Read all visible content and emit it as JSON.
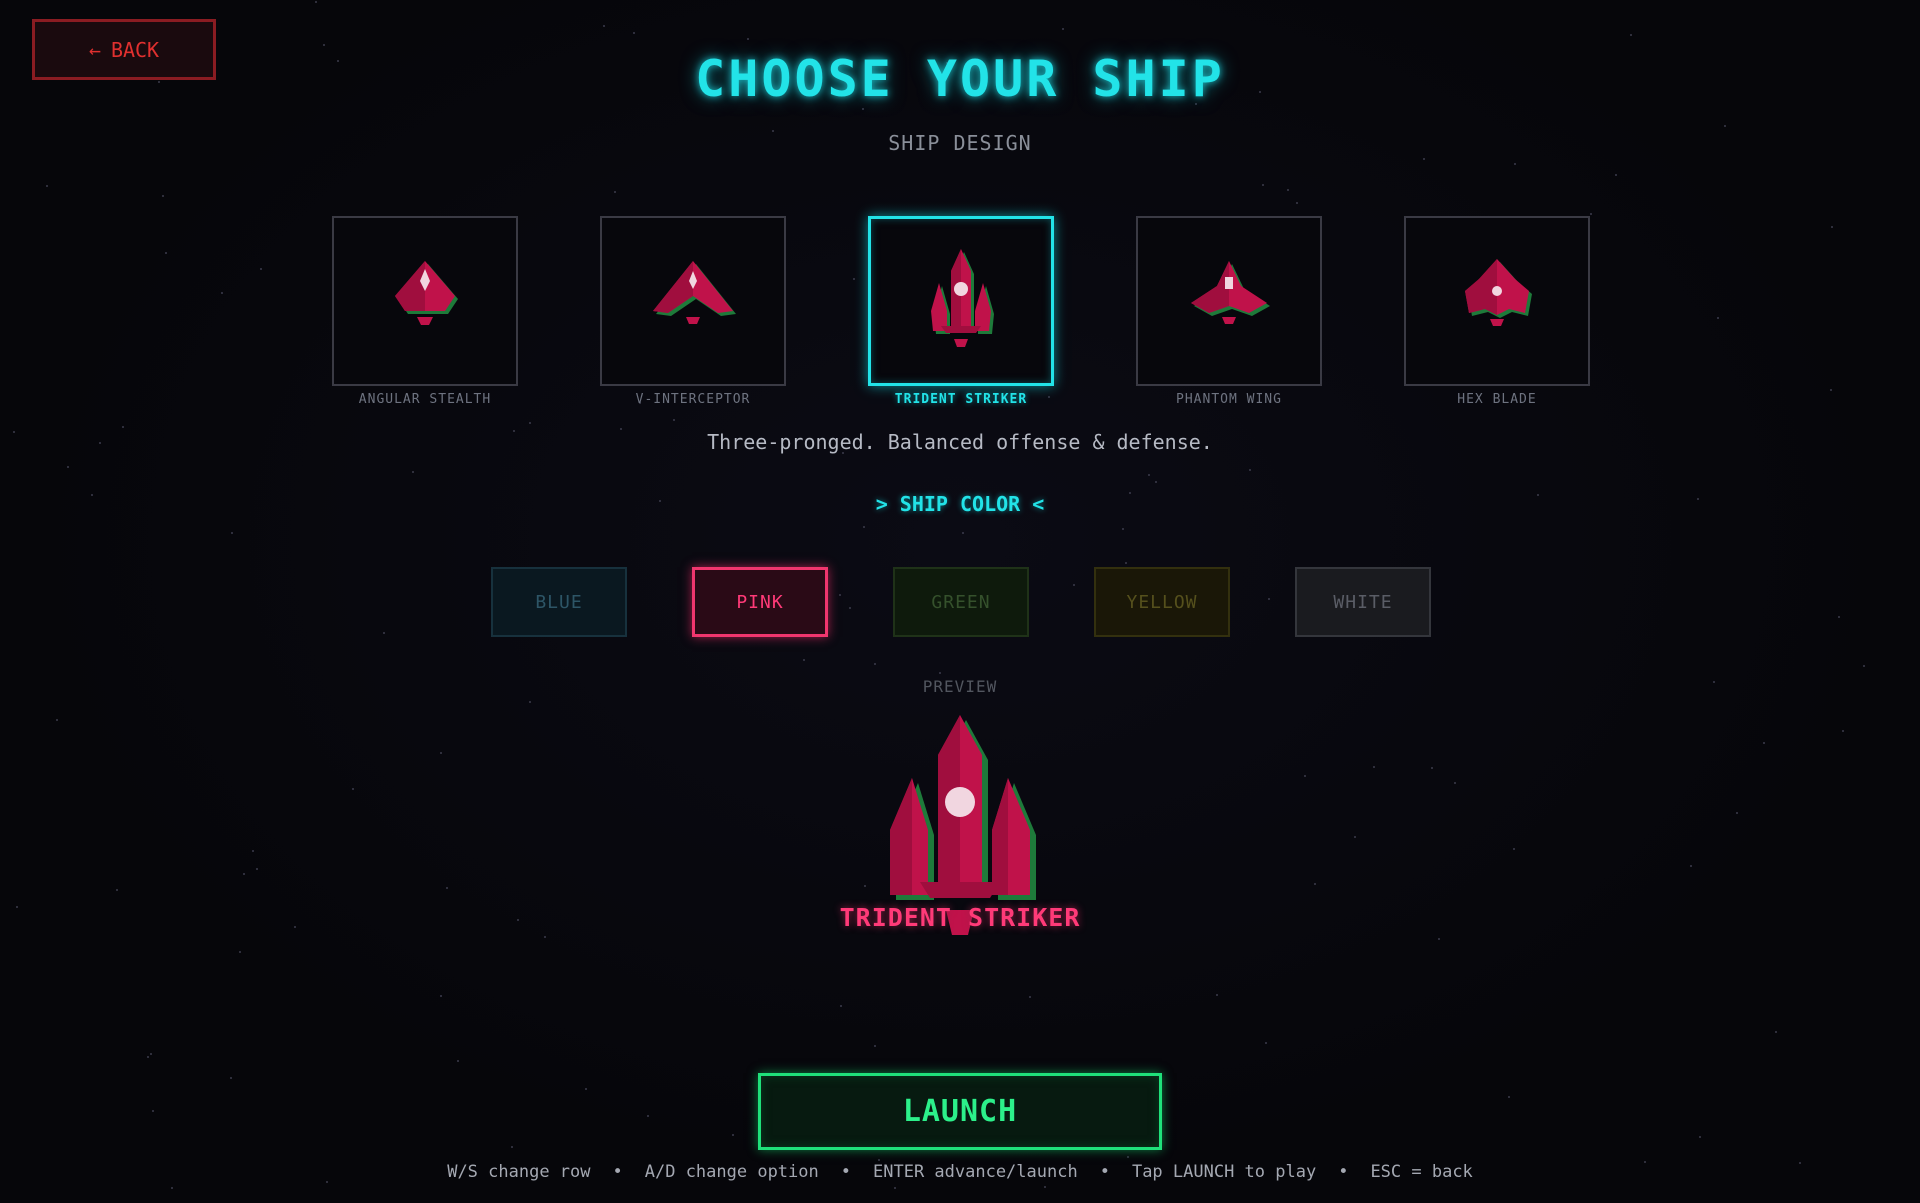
{
  "back_button": {
    "arrow": "←",
    "label": "BACK"
  },
  "title": "CHOOSE YOUR SHIP",
  "subtitle": "SHIP DESIGN",
  "designs": [
    {
      "name": "ANGULAR STEALTH",
      "icon": "angular-stealth-ship-icon",
      "selected": false
    },
    {
      "name": "V-INTERCEPTOR",
      "icon": "v-interceptor-ship-icon",
      "selected": false
    },
    {
      "name": "TRIDENT STRIKER",
      "icon": "trident-striker-ship-icon",
      "selected": true
    },
    {
      "name": "PHANTOM WING",
      "icon": "phantom-wing-ship-icon",
      "selected": false
    },
    {
      "name": "HEX BLADE",
      "icon": "hex-blade-ship-icon",
      "selected": false
    }
  ],
  "description": "Three-pronged. Balanced offense & defense.",
  "color_heading": "> SHIP COLOR <",
  "colors": [
    {
      "label": "BLUE",
      "selected": false
    },
    {
      "label": "PINK",
      "selected": true
    },
    {
      "label": "GREEN",
      "selected": false
    },
    {
      "label": "YELLOW",
      "selected": false
    },
    {
      "label": "WHITE",
      "selected": false
    }
  ],
  "preview": {
    "label": "PREVIEW",
    "name": "TRIDENT STRIKER"
  },
  "launch_button": "LAUNCH",
  "hints": [
    "W/S change row",
    "A/D change option",
    "ENTER advance/launch",
    "Tap LAUNCH to play",
    "ESC = back"
  ],
  "palette": {
    "accent": "#22e3e8",
    "ship": "#c0124a",
    "ship_light": "#e81e64",
    "ship_shadow": "#1e7a3a",
    "launch": "#1fe07a",
    "back": "#e0302f"
  }
}
